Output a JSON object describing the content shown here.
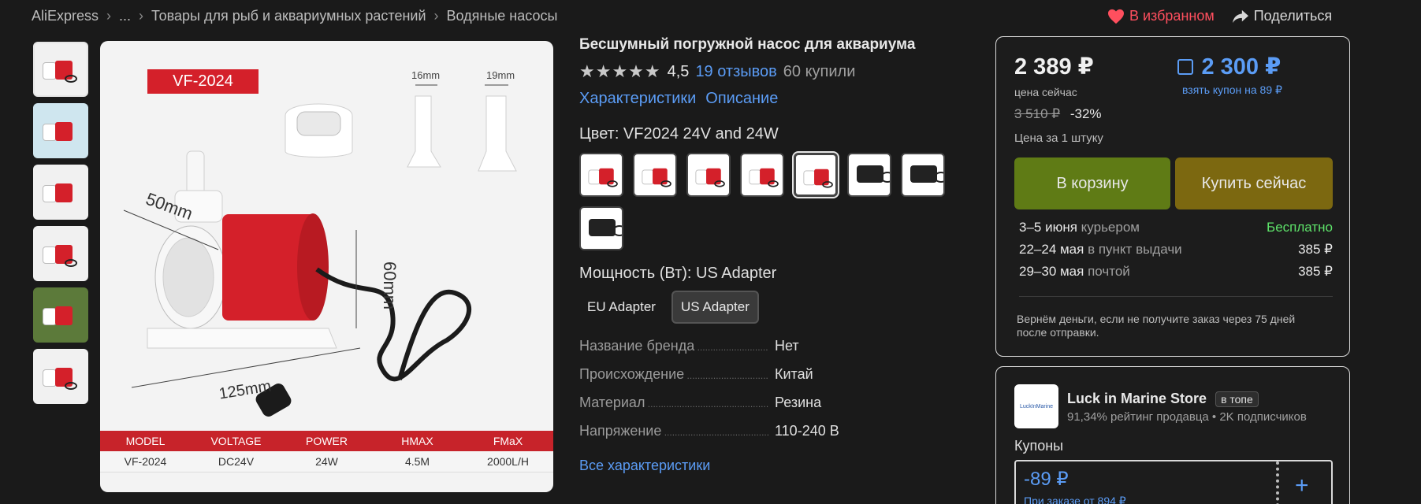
{
  "breadcrumb": {
    "items": [
      "AliExpress",
      "...",
      "Товары для рыб и аквариумных растений",
      "Водяные насосы"
    ]
  },
  "actions": {
    "favorite": "В избранном",
    "share": "Поделиться"
  },
  "image": {
    "model_tag": "VF-2024",
    "dims": {
      "d1": "16mm",
      "d2": "19mm",
      "d3": "50mm",
      "d4": "60mm",
      "d5": "125mm"
    },
    "spec_table": {
      "headers": [
        "MODEL",
        "VOLTAGE",
        "POWER",
        "HMAX",
        "FMaX"
      ],
      "values": [
        "VF-2024",
        "DC24V",
        "24W",
        "4.5M",
        "2000L/H"
      ]
    }
  },
  "product": {
    "title": "Бесшумный погружной насос для аквариума",
    "rating": "4,5",
    "reviews": "19 отзывов",
    "bought": "60 купили",
    "tab_specs": "Характеристики",
    "tab_desc": "Описание",
    "color_label": "Цвет: VF2024 24V and 24W",
    "power_label": "Мощность (Вт): US Adapter",
    "power_options": [
      "EU Adapter",
      "US Adapter"
    ],
    "props": [
      {
        "k": "Название бренда",
        "v": "Нет"
      },
      {
        "k": "Происхождение",
        "v": "Китай"
      },
      {
        "k": "Материал",
        "v": "Резина"
      },
      {
        "k": "Напряжение",
        "v": "110-240 В"
      }
    ],
    "all_props": "Все характеристики"
  },
  "buy": {
    "price_now": "2 389 ₽",
    "price_now_label": "цена сейчас",
    "coupon_price": "2 300 ₽",
    "coupon_label": "взять купон на 89 ₽",
    "old_price": "3 510 ₽",
    "discount": "-32%",
    "per_unit": "Цена за 1 штуку",
    "btn_cart": "В корзину",
    "btn_buy": "Купить сейчас",
    "delivery": [
      {
        "date": "3–5 июня",
        "method": "курьером",
        "price": "Бесплатно"
      },
      {
        "date": "22–24 мая",
        "method": "в пункт выдачи",
        "price": "385 ₽"
      },
      {
        "date": "29–30 мая",
        "method": "почтой",
        "price": "385 ₽"
      }
    ],
    "refund": "Вернём деньги, если не получите заказ через 75 дней после отправки."
  },
  "store": {
    "name": "Luck in Marine Store",
    "badge": "в топе",
    "meta": "91,34% рейтинг продавца • 2K подписчиков",
    "coupons_label": "Купоны",
    "coupon_value": "-89 ₽",
    "coupon_cond": "При заказе от 894 ₽",
    "logo_text": "LuckInMarine"
  }
}
